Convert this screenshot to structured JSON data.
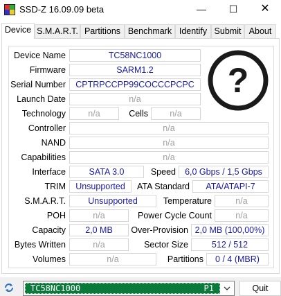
{
  "window": {
    "title": "SSD-Z 16.09.09 beta",
    "minimize": "—",
    "maximize": "☐",
    "close": "✕",
    "icon": "ssdz-app-icon"
  },
  "tabs": [
    "Device",
    "S.M.A.R.T.",
    "Partitions",
    "Benchmark",
    "Identify",
    "Submit",
    "About"
  ],
  "active_tab": "Device",
  "device": {
    "labels": {
      "device_name": "Device Name",
      "firmware": "Firmware",
      "serial_number": "Serial Number",
      "launch_date": "Launch Date",
      "technology": "Technology",
      "cells": "Cells",
      "controller": "Controller",
      "nand": "NAND",
      "capabilities": "Capabilities",
      "interface": "Interface",
      "speed": "Speed",
      "trim": "TRIM",
      "ata_standard": "ATA Standard",
      "smart": "S.M.A.R.T.",
      "temperature": "Temperature",
      "poh": "POH",
      "power_cycle_count": "Power Cycle Count",
      "capacity": "Capacity",
      "over_provision": "Over-Provision",
      "bytes_written": "Bytes Written",
      "sector_size": "Sector Size",
      "volumes": "Volumes",
      "partitions": "Partitions"
    },
    "values": {
      "device_name": "TC58NC1000",
      "firmware": "SARM1.2",
      "serial_number": "CPTRPCCPP99COCCCPCPC",
      "launch_date": "n/a",
      "technology": "n/a",
      "cells": "n/a",
      "controller": "n/a",
      "nand": "n/a",
      "capabilities": "n/a",
      "interface": "SATA 3.0",
      "speed": "6,0 Gbps / 1,5 Gbps",
      "trim": "Unsupported",
      "ata_standard": "ATA/ATAPI-7",
      "smart": "Unsupported",
      "temperature": "n/a",
      "poh": "n/a",
      "power_cycle_count": "n/a",
      "capacity": "2,0 MB",
      "over_provision": "2,0 MB (100,00%)",
      "bytes_written": "n/a",
      "sector_size": "512 / 512",
      "volumes": "n/a",
      "partitions": "0 / 4 (MBR)"
    },
    "logo": {
      "icon": "unknown-question-mark-icon",
      "glyph": "?"
    }
  },
  "bottom": {
    "refresh_icon": "refresh-icon",
    "drive_name": "TC58NC1000",
    "drive_port": "P1",
    "quit_label": "Quit"
  },
  "colors": {
    "value_text": "#1a1aa6",
    "na_text": "#a0a0a0",
    "selected_drive_bg": "#0a7a3a"
  }
}
